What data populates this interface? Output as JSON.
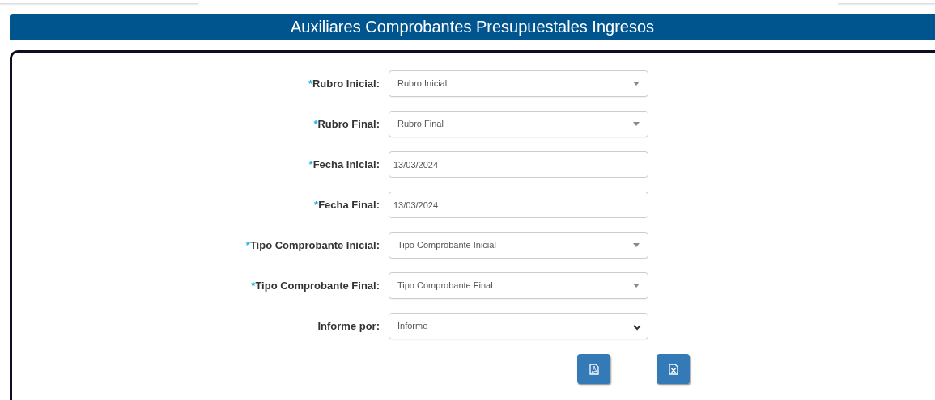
{
  "title": "Auxiliares Comprobantes Presupuestales Ingresos",
  "fields": [
    {
      "mark": "*",
      "label": "Rubro Inicial:",
      "kind": "select",
      "placeholder": "Rubro Inicial"
    },
    {
      "mark": "*",
      "label": "Rubro Final:",
      "kind": "select",
      "placeholder": "Rubro Final"
    },
    {
      "mark": "*",
      "label": "Fecha Inicial:",
      "kind": "date",
      "value": "13/03/2024"
    },
    {
      "mark": "*",
      "label": "Fecha Final:",
      "kind": "date",
      "value": "13/03/2024"
    },
    {
      "mark": "*",
      "label": "Tipo Comprobante Inicial:",
      "kind": "select",
      "placeholder": "Tipo Comprobante Inicial"
    },
    {
      "mark": "*",
      "label": "Tipo Comprobante Final:",
      "kind": "select",
      "placeholder": "Tipo Comprobante Final"
    },
    {
      "label": "Informe por:",
      "kind": "dropdown",
      "value": "Informe"
    }
  ],
  "buttons": [
    {
      "kind": "pdf"
    },
    {
      "kind": "excel"
    }
  ]
}
